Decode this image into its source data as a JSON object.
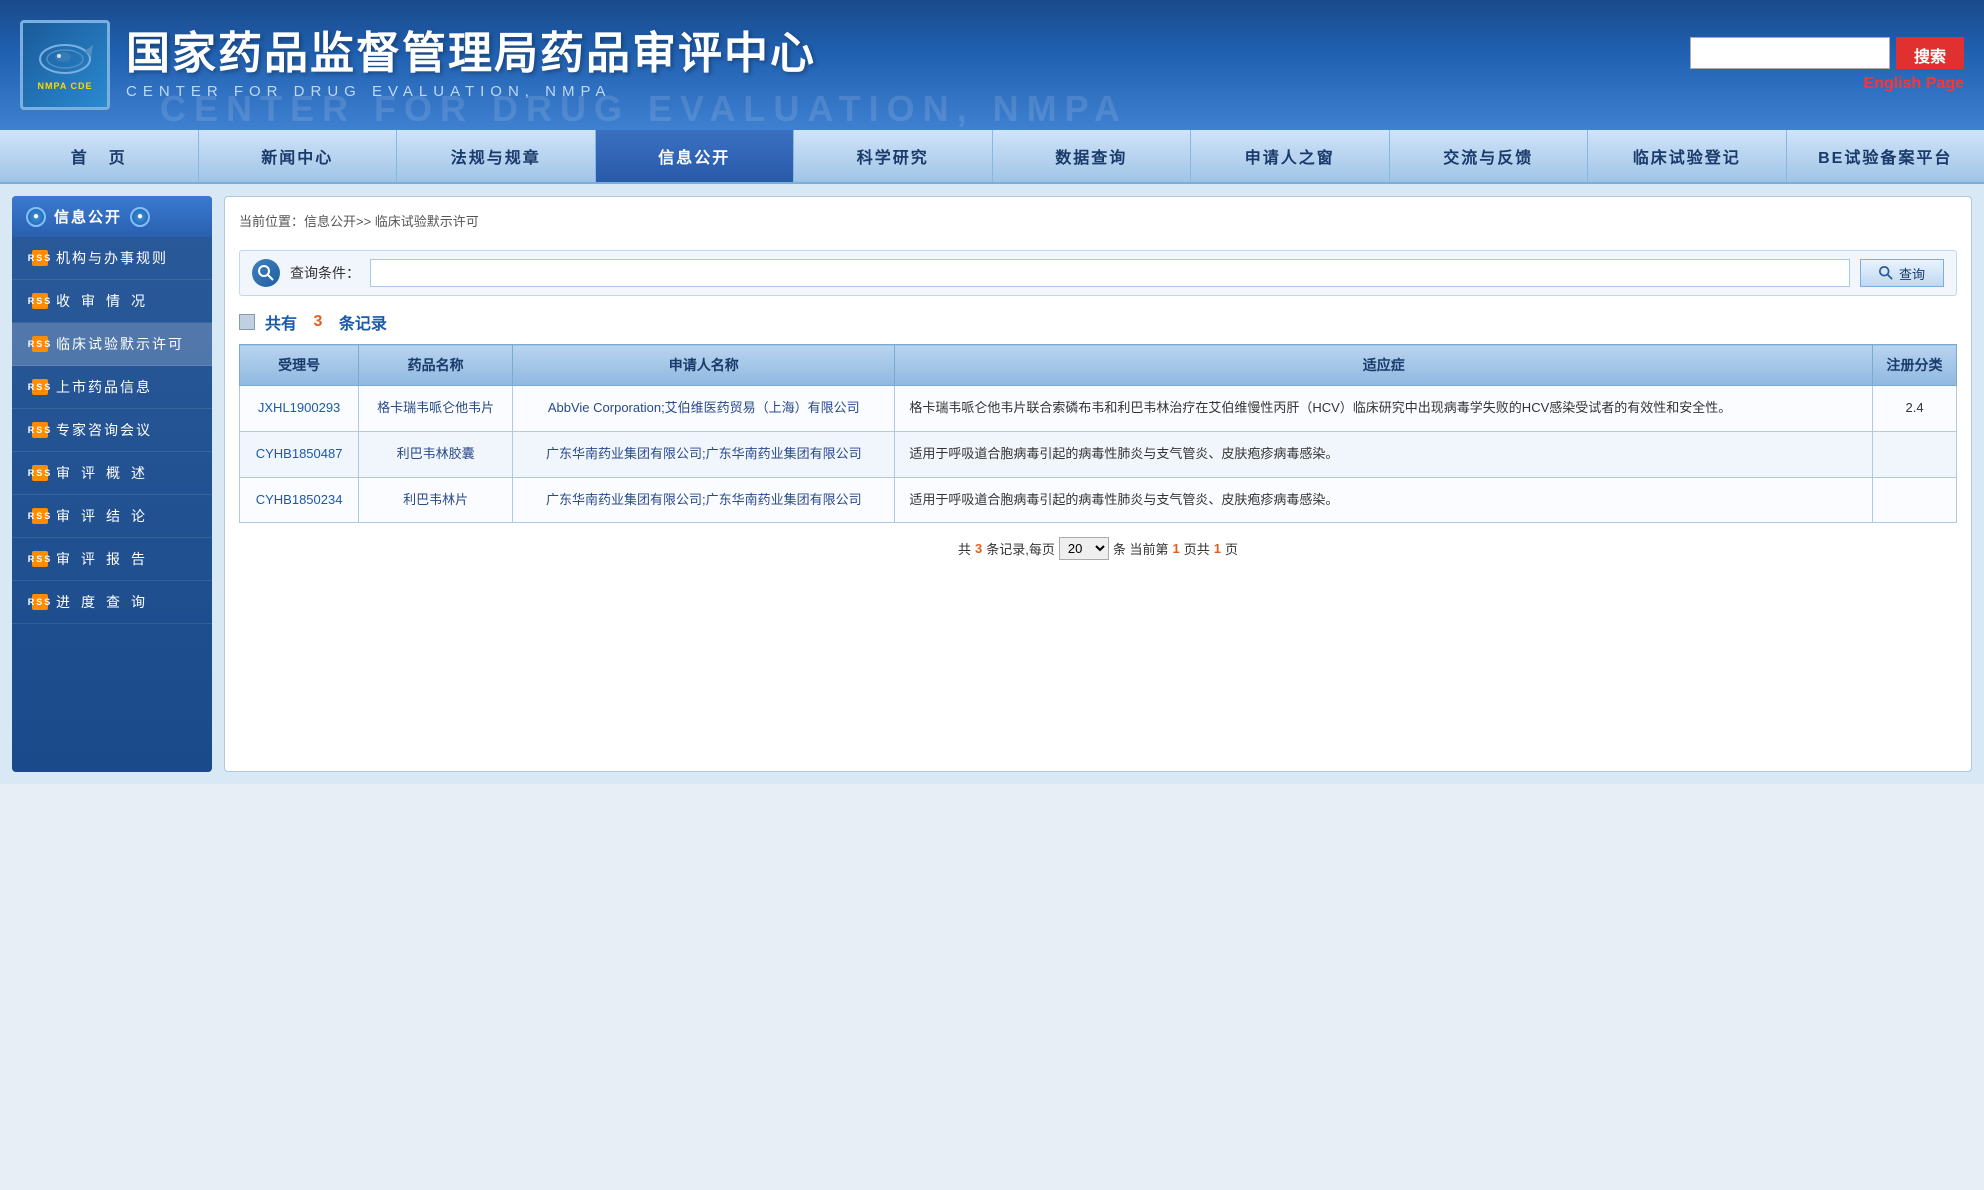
{
  "header": {
    "logo_text": "NMPA CDE",
    "title_cn": "国家药品监督管理局药品审评中心",
    "title_en": "CENTER FOR DRUG EVALUATION, NMPA",
    "title_en_shadow": "CENTER FOR DRUG EVALUATION, NMPA",
    "search_placeholder": "",
    "search_btn_label": "搜索",
    "english_page_label": "English Page"
  },
  "nav": {
    "items": [
      {
        "label": "首  页",
        "active": false
      },
      {
        "label": "新闻中心",
        "active": false
      },
      {
        "label": "法规与规章",
        "active": false
      },
      {
        "label": "信息公开",
        "active": true
      },
      {
        "label": "科学研究",
        "active": false
      },
      {
        "label": "数据查询",
        "active": false
      },
      {
        "label": "申请人之窗",
        "active": false
      },
      {
        "label": "交流与反馈",
        "active": false
      },
      {
        "label": "临床试验登记",
        "active": false
      },
      {
        "label": "BE试验备案平台",
        "active": false
      }
    ]
  },
  "sidebar": {
    "header_label": "信息公开",
    "items": [
      {
        "label": "机构与办事规则",
        "active": false
      },
      {
        "label": "收  审  情  况",
        "active": false
      },
      {
        "label": "临床试验默示许可",
        "active": true
      },
      {
        "label": "上市药品信息",
        "active": false
      },
      {
        "label": "专家咨询会议",
        "active": false
      },
      {
        "label": "审  评  概  述",
        "active": false
      },
      {
        "label": "审  评  结  论",
        "active": false
      },
      {
        "label": "审  评  报  告",
        "active": false
      },
      {
        "label": "进  度  查  询",
        "active": false
      }
    ]
  },
  "content": {
    "breadcrumb": "当前位置：信息公开>> 临床试验默示许可",
    "search_label": "查询条件：",
    "search_btn_label": "查询",
    "record_summary": "共有",
    "record_count": "3",
    "record_unit": "条记录",
    "table_headers": [
      "受理号",
      "药品名称",
      "申请人名称",
      "适应症",
      "注册分类"
    ],
    "rows": [
      {
        "id": "JXHL1900293",
        "drug_name": "格卡瑞韦哌仑他韦片",
        "applicant": "AbbVie Corporation;艾伯维医药贸易（上海）有限公司",
        "indication": "格卡瑞韦哌仑他韦片联合索磷布韦和利巴韦林治疗在艾伯维慢性丙肝（HCV）临床研究中出现病毒学失败的HCV感染受试者的有效性和安全性。",
        "reg_class": "2.4"
      },
      {
        "id": "CYHB1850487",
        "drug_name": "利巴韦林胶囊",
        "applicant": "广东华南药业集团有限公司;广东华南药业集团有限公司",
        "indication": "适用于呼吸道合胞病毒引起的病毒性肺炎与支气管炎、皮肤疱疹病毒感染。",
        "reg_class": ""
      },
      {
        "id": "CYHB1850234",
        "drug_name": "利巴韦林片",
        "applicant": "广东华南药业集团有限公司;广东华南药业集团有限公司",
        "indication": "适用于呼吸道合胞病毒引起的病毒性肺炎与支气管炎、皮肤疱疹病毒感染。",
        "reg_class": ""
      }
    ],
    "pagination": {
      "total_records_label": "共",
      "total_records": "3",
      "per_page_label": "条记录,每页",
      "per_page_value": "20",
      "current_label": "条 当前第",
      "current_page": "1",
      "total_pages_label": "页共",
      "total_pages": "1",
      "end_label": "页"
    }
  }
}
